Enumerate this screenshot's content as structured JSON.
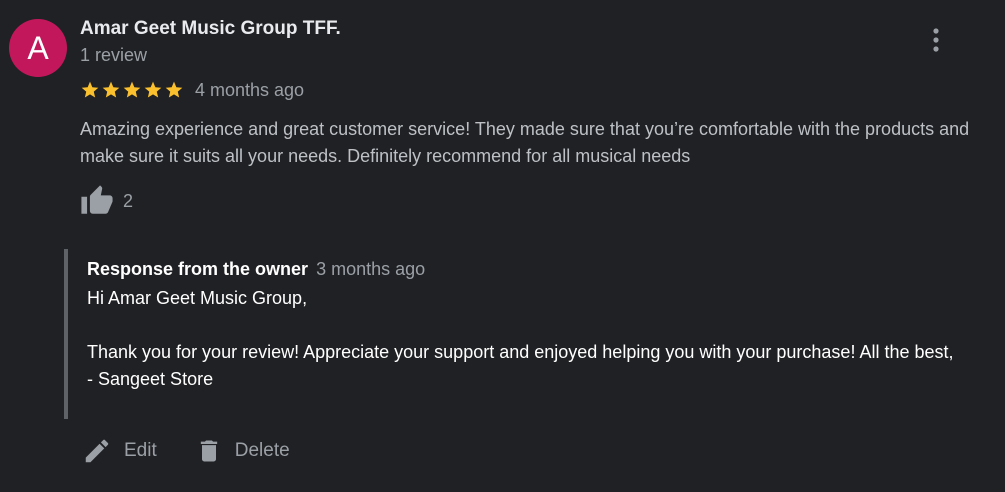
{
  "reviewer": {
    "initial": "A",
    "name": "Amar Geet Music Group TFF.",
    "review_count": "1 review",
    "avatar_color": "#c2185b"
  },
  "review": {
    "rating": 5,
    "max_rating": 5,
    "time": "4 months ago",
    "text": "Amazing experience and great customer service! They made sure that you’re comfortable with the products and make sure it suits all your needs. Definitely recommend for all musical needs",
    "likes": "2"
  },
  "response": {
    "label": "Response from the owner",
    "time": "3 months ago",
    "greeting": "Hi Amar Geet Music Group,",
    "body": "Thank you for your review! Appreciate your support and enjoyed helping you with your purchase! All the best,",
    "signature": "- Sangeet Store"
  },
  "actions": {
    "edit_label": "Edit",
    "delete_label": "Delete"
  },
  "icons": {
    "more": "more-vert-icon",
    "star": "star-icon",
    "like": "thumb-up-icon",
    "edit": "pencil-icon",
    "delete": "trash-icon"
  },
  "colors": {
    "background": "#202124",
    "star": "#fbc02d",
    "muted_text": "#9aa0a6",
    "body_text": "#bdc1c6"
  }
}
